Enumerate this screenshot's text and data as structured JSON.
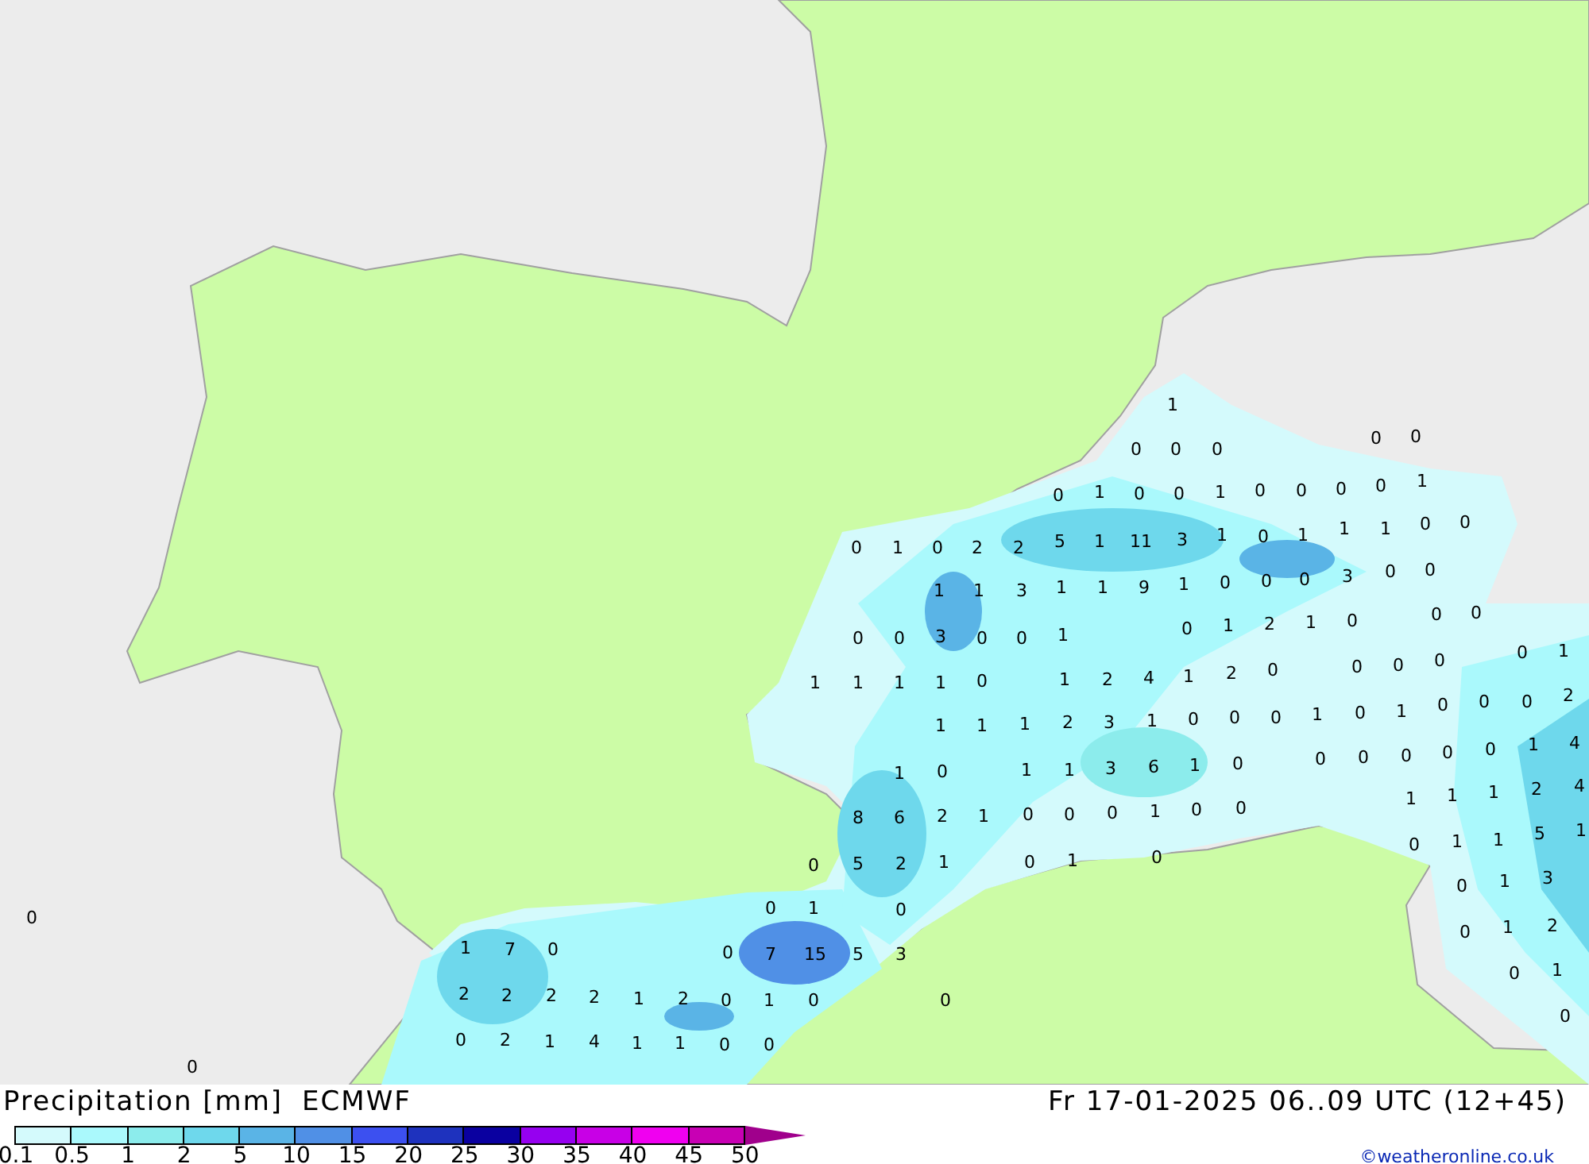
{
  "map": {
    "values": [
      "1",
      "0",
      "0",
      "0",
      "0",
      "0",
      "0",
      "1",
      "0",
      "0",
      "1",
      "0",
      "0",
      "0",
      "0",
      "1",
      "0",
      "1",
      "0",
      "2",
      "2",
      "5",
      "1",
      "11",
      "3",
      "1",
      "0",
      "1",
      "1",
      "1",
      "0",
      "0",
      "1",
      "1",
      "3",
      "1",
      "1",
      "9",
      "1",
      "0",
      "0",
      "0",
      "3",
      "0",
      "0",
      "0",
      "0",
      "3",
      "0",
      "0",
      "1",
      "0",
      "1",
      "2",
      "1",
      "0",
      "0",
      "0",
      "1",
      "1",
      "1",
      "1",
      "0",
      "1",
      "2",
      "4",
      "1",
      "2",
      "0",
      "0",
      "0",
      "0",
      "0",
      "1",
      "1",
      "1",
      "1",
      "2",
      "3",
      "1",
      "0",
      "0",
      "0",
      "1",
      "0",
      "1",
      "0",
      "0",
      "0",
      "2",
      "0",
      "0",
      "0",
      "0",
      "0",
      "1",
      "4",
      "1",
      "0",
      "1",
      "1",
      "3",
      "6",
      "1",
      "0",
      "8",
      "6",
      "2",
      "1",
      "0",
      "0",
      "0",
      "1",
      "0",
      "0",
      "1",
      "1",
      "1",
      "2",
      "4",
      "0",
      "5",
      "2",
      "1",
      "0",
      "1",
      "0",
      "0",
      "1",
      "1",
      "5",
      "1",
      "0",
      "1",
      "0",
      "0",
      "1",
      "3",
      "0",
      "1",
      "7",
      "0",
      "0",
      "7",
      "15",
      "5",
      "3",
      "0",
      "1",
      "2",
      "2",
      "2",
      "2",
      "2",
      "1",
      "2",
      "0",
      "1",
      "0",
      "0",
      "0",
      "1",
      "0",
      "0",
      "2",
      "1",
      "4",
      "1",
      "1",
      "0",
      "0",
      "0"
    ]
  },
  "legend": {
    "title": "Precipitation [mm]",
    "model": "ECMWF",
    "bins": [
      {
        "color": "#d4fafc"
      },
      {
        "color": "#aaf9fc"
      },
      {
        "color": "#8cecec"
      },
      {
        "color": "#6ed8ec"
      },
      {
        "color": "#5ab4e6"
      },
      {
        "color": "#5090e6"
      },
      {
        "color": "#3c50f0"
      },
      {
        "color": "#1e32be"
      },
      {
        "color": "#0a00a0"
      },
      {
        "color": "#9600f0"
      },
      {
        "color": "#c800e6"
      },
      {
        "color": "#f000f0"
      },
      {
        "color": "#c800b4"
      },
      {
        "color": "#a0008c"
      }
    ],
    "ticks": [
      "0.1",
      "0.5",
      "1",
      "2",
      "5",
      "10",
      "15",
      "20",
      "25",
      "30",
      "35",
      "40",
      "45",
      "50"
    ]
  },
  "valid_time": "Fr 17-01-2025 06..09 UTC (12+45)",
  "credit": "©weatheronline.co.uk"
}
